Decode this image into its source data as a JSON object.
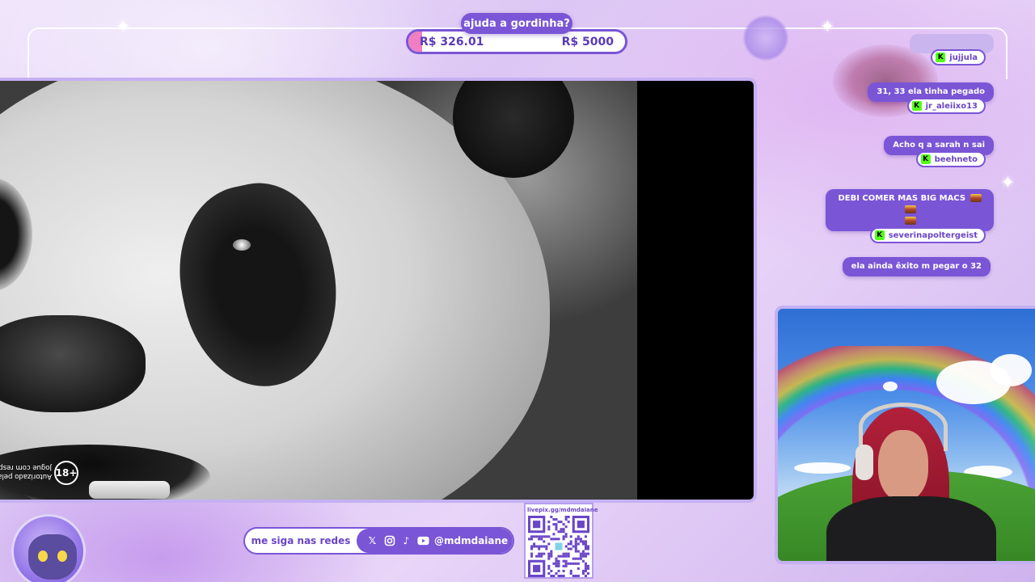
{
  "goal": {
    "title": "ajuda a gordinha?",
    "current": "R$ 326.01",
    "target": "R$ 5000",
    "progress_fraction": 0.065
  },
  "video": {
    "age_rating": "18+",
    "disclaimer_line1": "Jogue com respon",
    "disclaimer_line2": "Autorizado pela P"
  },
  "chat": {
    "messages": [
      {
        "text": "",
        "user": "jujjula"
      },
      {
        "text": "31, 33 ela tinha pegado",
        "user": "jr_aleiixo13"
      },
      {
        "text": "Acho q a sarah n sai",
        "user": "beehneto"
      },
      {
        "text": "DEBI COMER MAS BIG MACS",
        "user": "severinapoltergeist"
      },
      {
        "text": "ela ainda êxito m pegar o 32",
        "user": ""
      }
    ],
    "platform_icon": "K"
  },
  "socials": {
    "label": "me siga nas redes",
    "handle": "@mdmdaiane",
    "icons": [
      "x-icon",
      "instagram-icon",
      "tiktok-icon",
      "youtube-icon"
    ]
  },
  "qr": {
    "label": "livepix.gg/mdmdaiane"
  },
  "colors": {
    "accent": "#7a55d6",
    "goal_fill": "#f07ec2",
    "kick": "#53fc18"
  }
}
